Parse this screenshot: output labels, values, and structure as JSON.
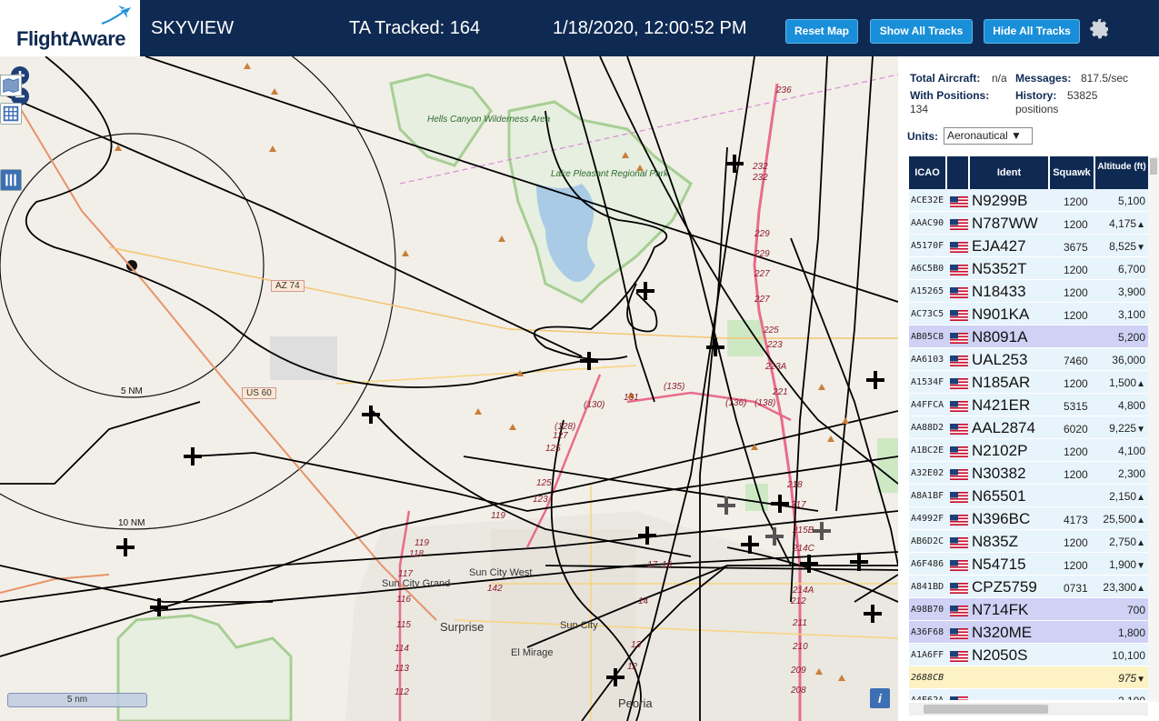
{
  "header": {
    "logo_text": "FlightAware",
    "app_title": "SKYVIEW",
    "tracked": "TA Tracked: 164",
    "datetime": "1/18/2020, 12:00:52 PM",
    "buttons": {
      "reset": "Reset Map",
      "show": "Show All Tracks",
      "hide": "Hide All Tracks"
    },
    "settings_icon": "gear-icon"
  },
  "map": {
    "zoom_in_icon": "plus-icon",
    "zoom_out_icon": "minus-icon",
    "side_buttons": [
      "map-layers-icon",
      "grid-icon",
      "columns-icon"
    ],
    "scale": "5 nm",
    "info": "i",
    "labels": {
      "hells_canyon": "Hells Canyon Wilderness Area",
      "lake_pleasant": "Lake Pleasant Regional Park",
      "az74": "AZ 74",
      "us60": "US 60",
      "ring5": "5 NM",
      "ring10": "10 NM",
      "sun_city_grand": "Sun City Grand",
      "sun_city_west": "Sun City West",
      "surprise": "Surprise",
      "sun_city": "Sun City",
      "el_mirage": "El Mirage",
      "peoria": "Peoria"
    },
    "road_markers": [
      "236",
      "232",
      "232",
      "229",
      "229",
      "227",
      "227",
      "225",
      "223",
      "223A",
      "221",
      "(135)",
      "(136)",
      "(138)",
      "131",
      "(130)",
      "(128)",
      "127",
      "125",
      "125",
      "123",
      "119",
      "119",
      "118",
      "117",
      "116",
      "115",
      "114",
      "113",
      "112",
      "142",
      "218",
      "217",
      "215B",
      "214C",
      "214A",
      "212",
      "211",
      "210",
      "209",
      "208",
      "17",
      "16",
      "14",
      "13",
      "12"
    ]
  },
  "panel": {
    "total_aircraft_label": "Total Aircraft:",
    "total_aircraft_value": "n/a",
    "messages_label": "Messages:",
    "messages_value": "817.5/sec",
    "with_positions_label": "With Positions:",
    "with_positions_value": "134",
    "history_label": "History:",
    "history_value": "53825",
    "history_unit": "positions",
    "units_label": "Units:",
    "units_value": "Aeronautical ▼",
    "columns": [
      "ICAO",
      "Ident",
      "Squawk",
      "Altitude (ft)"
    ],
    "rows": [
      {
        "icao": "ACE32E",
        "ident": "N9299B",
        "squawk": "1200",
        "alt": "5,100",
        "trend": "",
        "state": "normal"
      },
      {
        "icao": "AAAC90",
        "ident": "N787WW",
        "squawk": "1200",
        "alt": "4,175",
        "trend": "▲",
        "state": "normal"
      },
      {
        "icao": "A5170F",
        "ident": "EJA427",
        "squawk": "3675",
        "alt": "8,525",
        "trend": "▼",
        "state": "normal"
      },
      {
        "icao": "A6C5B0",
        "ident": "N5352T",
        "squawk": "1200",
        "alt": "6,700",
        "trend": "",
        "state": "normal"
      },
      {
        "icao": "A15265",
        "ident": "N18433",
        "squawk": "1200",
        "alt": "3,900",
        "trend": "",
        "state": "normal"
      },
      {
        "icao": "AC73C5",
        "ident": "N901KA",
        "squawk": "1200",
        "alt": "3,100",
        "trend": "",
        "state": "normal"
      },
      {
        "icao": "AB05C8",
        "ident": "N8091A",
        "squawk": "",
        "alt": "5,200",
        "trend": "",
        "state": "sel"
      },
      {
        "icao": "AA6103",
        "ident": "UAL253",
        "squawk": "7460",
        "alt": "36,000",
        "trend": "",
        "state": "normal"
      },
      {
        "icao": "A1534F",
        "ident": "N185AR",
        "squawk": "1200",
        "alt": "1,500",
        "trend": "▲",
        "state": "normal"
      },
      {
        "icao": "A4FFCA",
        "ident": "N421ER",
        "squawk": "5315",
        "alt": "4,800",
        "trend": "",
        "state": "normal"
      },
      {
        "icao": "AA88D2",
        "ident": "AAL2874",
        "squawk": "6020",
        "alt": "9,225",
        "trend": "▼",
        "state": "normal"
      },
      {
        "icao": "A1BC2E",
        "ident": "N2102P",
        "squawk": "1200",
        "alt": "4,100",
        "trend": "",
        "state": "normal"
      },
      {
        "icao": "A32E02",
        "ident": "N30382",
        "squawk": "1200",
        "alt": "2,300",
        "trend": "",
        "state": "normal"
      },
      {
        "icao": "A8A1BF",
        "ident": "N65501",
        "squawk": "",
        "alt": "2,150",
        "trend": "▲",
        "state": "normal"
      },
      {
        "icao": "A4992F",
        "ident": "N396BC",
        "squawk": "4173",
        "alt": "25,500",
        "trend": "▲",
        "state": "normal"
      },
      {
        "icao": "AB6D2C",
        "ident": "N835Z",
        "squawk": "1200",
        "alt": "2,750",
        "trend": "▲",
        "state": "normal"
      },
      {
        "icao": "A6F486",
        "ident": "N54715",
        "squawk": "1200",
        "alt": "1,900",
        "trend": "▼",
        "state": "normal"
      },
      {
        "icao": "A841BD",
        "ident": "CPZ5759",
        "squawk": "0731",
        "alt": "23,300",
        "trend": "▲",
        "state": "normal"
      },
      {
        "icao": "A98B70",
        "ident": "N714FK",
        "squawk": "",
        "alt": "700",
        "trend": "",
        "state": "sel"
      },
      {
        "icao": "A36F68",
        "ident": "N320ME",
        "squawk": "",
        "alt": "1,800",
        "trend": "",
        "state": "sel"
      },
      {
        "icao": "A1A6FF",
        "ident": "N2050S",
        "squawk": "",
        "alt": "10,100",
        "trend": "",
        "state": "normal"
      },
      {
        "icao": "2688CB",
        "ident": "",
        "squawk": "",
        "alt": "975",
        "trend": "▼",
        "state": "emg"
      },
      {
        "icao": "A4E62A",
        "ident": "",
        "squawk": "",
        "alt": "2,100",
        "trend": "",
        "state": "normal"
      }
    ]
  }
}
